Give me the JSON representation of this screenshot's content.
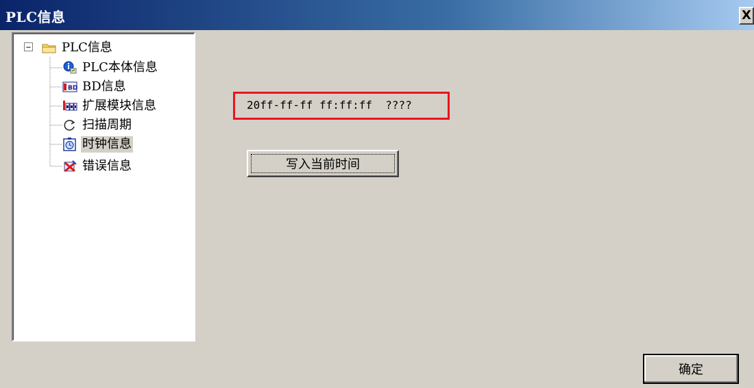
{
  "window": {
    "title": "PLC信息",
    "close_label": "X"
  },
  "tree": {
    "expander_symbol": "−",
    "root": {
      "label": "PLC信息",
      "icon": "folder-icon"
    },
    "children": [
      {
        "label": "PLC本体信息",
        "icon": "info-icon",
        "selected": false
      },
      {
        "label": "BD信息",
        "icon": "bd-board-icon",
        "selected": false
      },
      {
        "label": "扩展模块信息",
        "icon": "expansion-module-icon",
        "selected": false
      },
      {
        "label": "扫描周期",
        "icon": "refresh-cycle-icon",
        "selected": false
      },
      {
        "label": "时钟信息",
        "icon": "clock-icon",
        "selected": true
      },
      {
        "label": "错误信息",
        "icon": "error-icon",
        "selected": false
      }
    ]
  },
  "clock": {
    "time_value": "20ff-ff-ff ff:ff:ff  ????",
    "highlight_color": "#e8141e"
  },
  "buttons": {
    "write_time": "写入当前时间",
    "ok": "确定"
  },
  "colors": {
    "titlebar_start": "#0a246a",
    "titlebar_end": "#a6caf0",
    "window_bg": "#d4d0c8"
  }
}
